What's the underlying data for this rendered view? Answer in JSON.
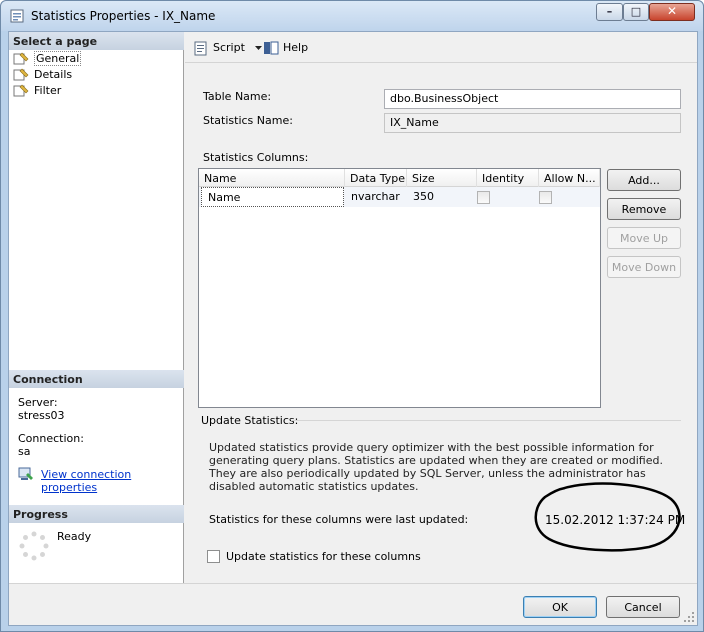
{
  "window": {
    "title": "Statistics Properties - IX_Name"
  },
  "title_controls": {
    "minimize": "–",
    "maximize": "□",
    "close": "✕"
  },
  "left": {
    "select_page_header": "Select a page",
    "pages": [
      {
        "label": "General",
        "icon": "page-wrench-icon"
      },
      {
        "label": "Details",
        "icon": "page-wrench-icon"
      },
      {
        "label": "Filter",
        "icon": "page-wrench-icon"
      }
    ],
    "connection_header": "Connection",
    "server_label": "Server:",
    "server_value": "stress03",
    "connection_label": "Connection:",
    "connection_value": "sa",
    "view_connection_link": "View connection properties",
    "progress_header": "Progress",
    "progress_status": "Ready"
  },
  "toolbar": {
    "script_label": "Script",
    "help_label": "Help"
  },
  "form": {
    "table_name_label": "Table Name:",
    "table_name_value": "dbo.BusinessObject",
    "stats_name_label": "Statistics Name:",
    "stats_name_value": "IX_Name",
    "stats_columns_label": "Statistics Columns:"
  },
  "grid": {
    "columns": [
      "Name",
      "Data Type",
      "Size",
      "Identity",
      "Allow N..."
    ],
    "rows": [
      {
        "name": "Name",
        "data_type": "nvarchar",
        "size": "350",
        "identity": false,
        "allow_nulls": false
      }
    ]
  },
  "side_buttons": {
    "add": "Add...",
    "remove": "Remove",
    "move_up": "Move Up",
    "move_down": "Move Down"
  },
  "update": {
    "section_label": "Update Statistics:",
    "description": "Updated statistics provide query optimizer with the best possible information for generating query plans. Statistics are updated when they are created or modified. They are also periodically updated by SQL Server, unless the administrator has disabled automatic statistics updates.",
    "last_updated_label": "Statistics for these columns were last updated:",
    "last_updated_value": "15.02.2012 1:37:24 PM",
    "checkbox_label": "Update statistics for these columns",
    "checkbox_checked": false
  },
  "footer": {
    "ok": "OK",
    "cancel": "Cancel"
  }
}
